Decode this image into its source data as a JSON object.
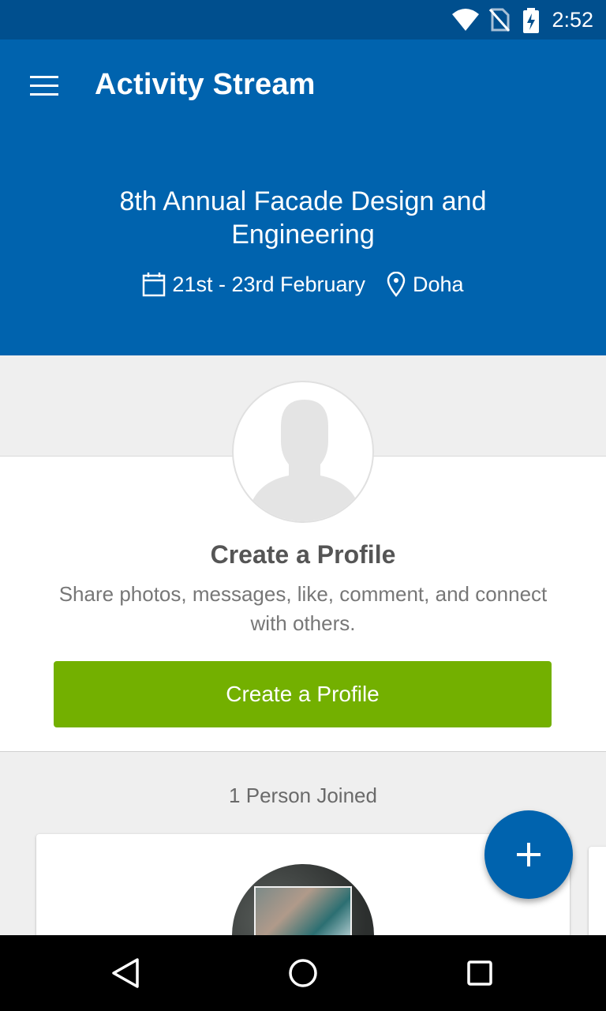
{
  "status_bar": {
    "time": "2:52"
  },
  "app_bar": {
    "title": "Activity Stream"
  },
  "event": {
    "title": "8th Annual Facade Design and Engineering",
    "dates": "21st - 23rd February",
    "location": "Doha"
  },
  "profile_prompt": {
    "heading": "Create a Profile",
    "description": "Share photos, messages, like, comment, and connect with others.",
    "button_label": "Create a Profile"
  },
  "members": {
    "joined_label": "1 Person Joined"
  },
  "colors": {
    "status_bar": "#004f8e",
    "primary": "#0063ae",
    "accent_button": "#73b000",
    "background": "#efefef"
  },
  "icons": {
    "menu": "menu-icon",
    "calendar": "calendar-icon",
    "location": "location-pin-icon",
    "fab": "plus-icon",
    "nav_back": "back-triangle-icon",
    "nav_home": "home-circle-icon",
    "nav_recents": "recents-square-icon"
  }
}
